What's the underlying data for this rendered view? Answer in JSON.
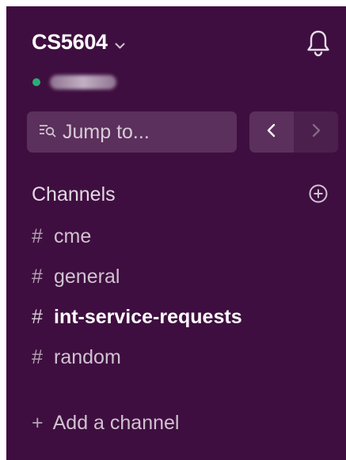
{
  "workspace": {
    "name": "CS5604",
    "chevron_icon": "chevron-down-icon",
    "bell_icon": "bell-icon",
    "presence_color": "#2bac76"
  },
  "jump": {
    "label": "Jump to...",
    "icon": "search-lines-icon"
  },
  "nav": {
    "back_icon": "chevron-left-icon",
    "forward_icon": "chevron-right-icon"
  },
  "channels_section": {
    "title": "Channels",
    "add_icon": "plus-circle-icon",
    "items": [
      {
        "hash": "#",
        "name": "cme",
        "unread": false
      },
      {
        "hash": "#",
        "name": "general",
        "unread": false
      },
      {
        "hash": "#",
        "name": "int-service-requests",
        "unread": true
      },
      {
        "hash": "#",
        "name": "random",
        "unread": false
      }
    ]
  },
  "add_channel": {
    "plus": "+",
    "label": "Add a channel"
  },
  "colors": {
    "sidebar_bg": "#3f0e40",
    "button_bg": "#5b305c",
    "text": "#cfc3cf",
    "text_bright": "#ffffff"
  }
}
